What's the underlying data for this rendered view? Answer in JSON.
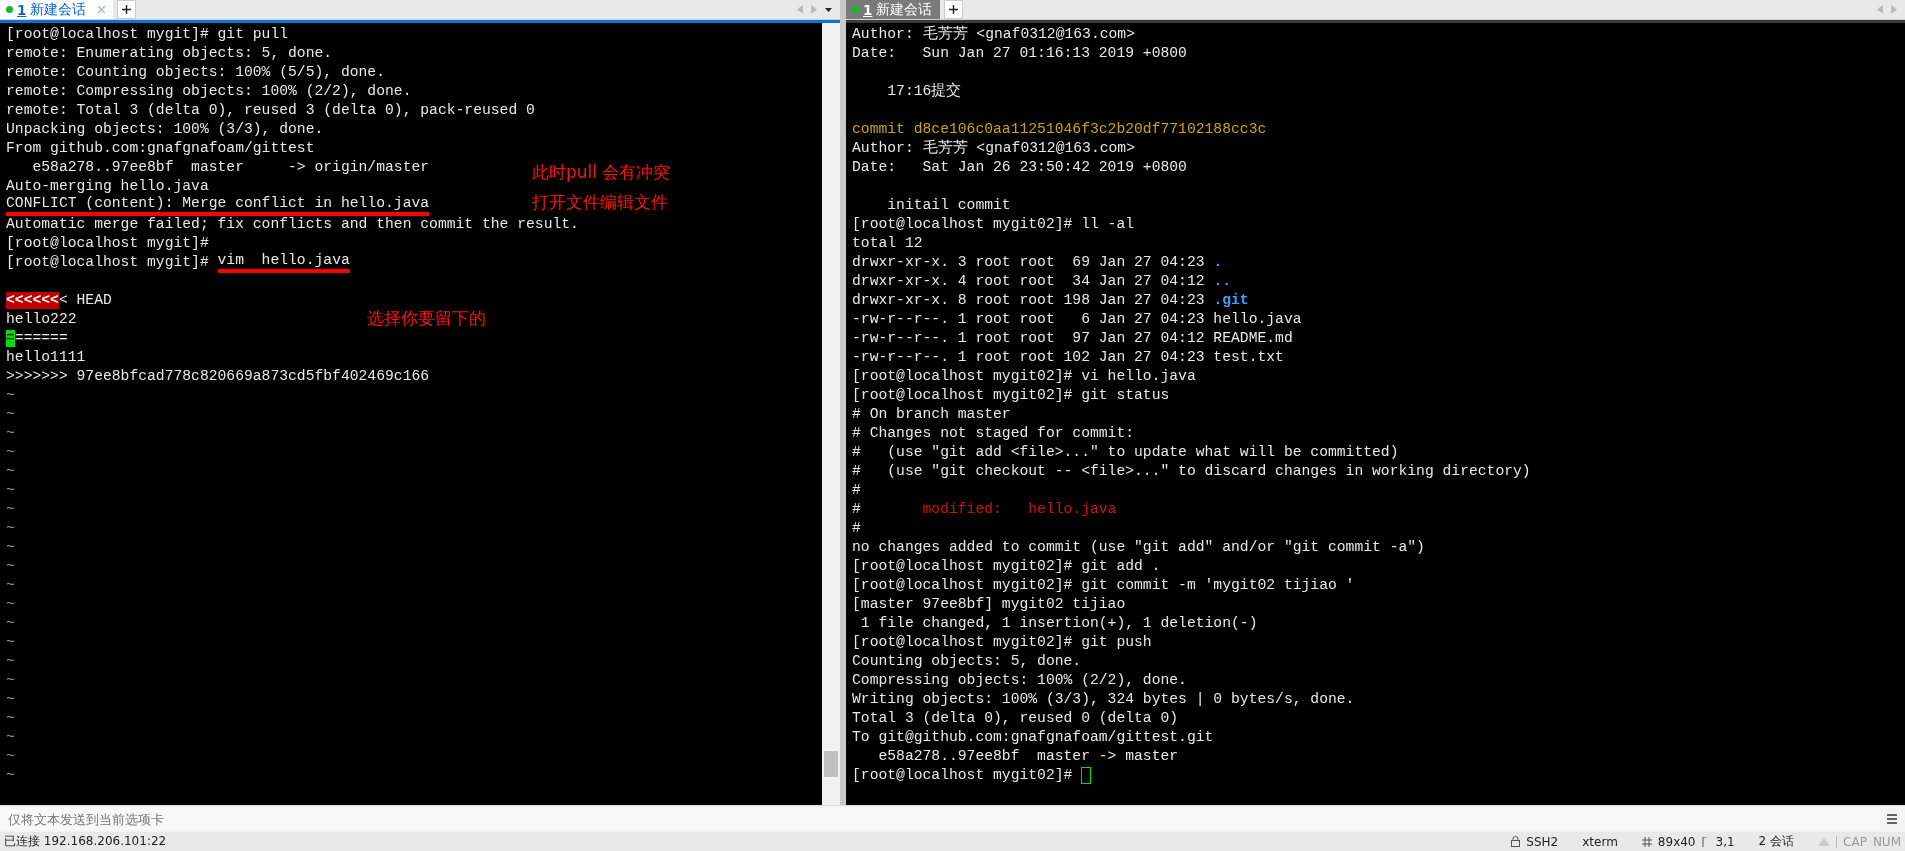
{
  "panes": [
    {
      "tabs": [
        {
          "number": "1",
          "label": "新建会话",
          "selected": true,
          "connected": true
        }
      ],
      "focused": true,
      "lines": [
        {
          "segments": [
            {
              "text": "[root@localhost mygit]# git pull"
            }
          ]
        },
        {
          "segments": [
            {
              "text": "remote: Enumerating objects: 5, done."
            }
          ]
        },
        {
          "segments": [
            {
              "text": "remote: Counting objects: 100% (5/5), done."
            }
          ]
        },
        {
          "segments": [
            {
              "text": "remote: Compressing objects: 100% (2/2), done."
            }
          ]
        },
        {
          "segments": [
            {
              "text": "remote: Total 3 (delta 0), reused 3 (delta 0), pack-reused 0"
            }
          ]
        },
        {
          "segments": [
            {
              "text": "Unpacking objects: 100% (3/3), done."
            }
          ]
        },
        {
          "segments": [
            {
              "text": "From github.com:gnafgnafoam/gittest"
            }
          ]
        },
        {
          "segments": [
            {
              "text": "   e58a278..97ee8bf  master     -> origin/master"
            }
          ]
        },
        {
          "segments": [
            {
              "text": "Auto-merging hello.java"
            }
          ]
        },
        {
          "segments": [
            {
              "text": "CONFLICT (content): Merge conflict in hello.java",
              "underlined": true
            }
          ]
        },
        {
          "segments": [
            {
              "text": "Automatic merge failed; fix conflicts and then commit the result."
            }
          ]
        },
        {
          "segments": [
            {
              "text": "[root@localhost mygit]#"
            }
          ]
        },
        {
          "segments": [
            {
              "text": "[root@localhost mygit]# "
            },
            {
              "text": "vim  hello.java",
              "underlined": true
            }
          ]
        },
        {
          "kind": "blank"
        },
        {
          "segments": [
            {
              "text": "<<<<<<",
              "kind": "highlight"
            },
            {
              "text": "< HEAD"
            }
          ]
        },
        {
          "segments": [
            {
              "text": "hello222"
            }
          ]
        },
        {
          "segments": [
            {
              "text": "=",
              "kind": "cursor"
            },
            {
              "text": "======"
            }
          ]
        },
        {
          "segments": [
            {
              "text": "hello1111"
            }
          ]
        },
        {
          "segments": [
            {
              "text": ">>>>>>> 97ee8bfcad778c820669a873cd5fbf402469c166"
            }
          ]
        },
        {
          "kind": "tilde",
          "segments": [
            {
              "text": "~"
            }
          ]
        },
        {
          "kind": "tilde",
          "segments": [
            {
              "text": "~"
            }
          ]
        },
        {
          "kind": "tilde",
          "segments": [
            {
              "text": "~"
            }
          ]
        },
        {
          "kind": "tilde",
          "segments": [
            {
              "text": "~"
            }
          ]
        },
        {
          "kind": "tilde",
          "segments": [
            {
              "text": "~"
            }
          ]
        },
        {
          "kind": "tilde",
          "segments": [
            {
              "text": "~"
            }
          ]
        },
        {
          "kind": "tilde",
          "segments": [
            {
              "text": "~"
            }
          ]
        },
        {
          "kind": "tilde",
          "segments": [
            {
              "text": "~"
            }
          ]
        },
        {
          "kind": "tilde",
          "segments": [
            {
              "text": "~"
            }
          ]
        },
        {
          "kind": "tilde",
          "segments": [
            {
              "text": "~"
            }
          ]
        },
        {
          "kind": "tilde",
          "segments": [
            {
              "text": "~"
            }
          ]
        },
        {
          "kind": "tilde",
          "segments": [
            {
              "text": "~"
            }
          ]
        },
        {
          "kind": "tilde",
          "segments": [
            {
              "text": "~"
            }
          ]
        },
        {
          "kind": "tilde",
          "segments": [
            {
              "text": "~"
            }
          ]
        },
        {
          "kind": "tilde",
          "segments": [
            {
              "text": "~"
            }
          ]
        },
        {
          "kind": "tilde",
          "segments": [
            {
              "text": "~"
            }
          ]
        },
        {
          "kind": "tilde",
          "segments": [
            {
              "text": "~"
            }
          ]
        },
        {
          "kind": "tilde",
          "segments": [
            {
              "text": "~"
            }
          ]
        },
        {
          "kind": "tilde",
          "segments": [
            {
              "text": "~"
            }
          ]
        },
        {
          "kind": "tilde",
          "segments": [
            {
              "text": "~"
            }
          ]
        },
        {
          "kind": "tilde",
          "segments": [
            {
              "text": "~"
            }
          ]
        }
      ],
      "annotations": [
        {
          "text": "此时pull  会有冲突"
        },
        {
          "text": "打开文件编辑文件"
        },
        {
          "text": "选择你要留下的"
        }
      ]
    },
    {
      "tabs": [
        {
          "number": "1",
          "label": "新建会话",
          "selected": true,
          "connected": true
        }
      ],
      "focused": false,
      "lines": [
        {
          "segments": [
            {
              "text": "Author: 毛芳芳 <gnaf0312@163.com>"
            }
          ]
        },
        {
          "segments": [
            {
              "text": "Date:   Sun Jan 27 01:16:13 2019 +0800"
            }
          ]
        },
        {
          "kind": "blank"
        },
        {
          "segments": [
            {
              "text": "    17:16提交"
            }
          ]
        },
        {
          "kind": "blank"
        },
        {
          "segments": [
            {
              "text": "commit d8ce106c0aa11251046f3c2b20df77102188cc3c",
              "kind": "commit-hash"
            }
          ]
        },
        {
          "segments": [
            {
              "text": "Author: 毛芳芳 <gnaf0312@163.com>"
            }
          ]
        },
        {
          "segments": [
            {
              "text": "Date:   Sat Jan 26 23:50:42 2019 +0800"
            }
          ]
        },
        {
          "kind": "blank"
        },
        {
          "segments": [
            {
              "text": "    initail commit"
            }
          ]
        },
        {
          "segments": [
            {
              "text": "[root@localhost mygit02]# ll -al"
            }
          ]
        },
        {
          "segments": [
            {
              "text": "total 12"
            }
          ]
        },
        {
          "segments": [
            {
              "text": "drwxr-xr-x. 3 root root  69 Jan 27 04:23 "
            },
            {
              "text": ".",
              "kind": "directory"
            }
          ]
        },
        {
          "segments": [
            {
              "text": "drwxr-xr-x. 4 root root  34 Jan 27 04:12 "
            },
            {
              "text": "..",
              "kind": "directory"
            }
          ]
        },
        {
          "segments": [
            {
              "text": "drwxr-xr-x. 8 root root 198 Jan 27 04:23 "
            },
            {
              "text": ".git",
              "kind": "directory"
            }
          ]
        },
        {
          "segments": [
            {
              "text": "-rw-r--r--. 1 root root   6 Jan 27 04:23 hello.java"
            }
          ]
        },
        {
          "segments": [
            {
              "text": "-rw-r--r--. 1 root root  97 Jan 27 04:12 README.md"
            }
          ]
        },
        {
          "segments": [
            {
              "text": "-rw-r--r--. 1 root root 102 Jan 27 04:23 test.txt"
            }
          ]
        },
        {
          "segments": [
            {
              "text": "[root@localhost mygit02]# vi hello.java"
            }
          ]
        },
        {
          "segments": [
            {
              "text": "[root@localhost mygit02]# git status"
            }
          ]
        },
        {
          "segments": [
            {
              "text": "# On branch master"
            }
          ]
        },
        {
          "segments": [
            {
              "text": "# Changes not staged for commit:"
            }
          ]
        },
        {
          "segments": [
            {
              "text": "#   (use \"git add <file>...\" to update what will be committed)"
            }
          ]
        },
        {
          "segments": [
            {
              "text": "#   (use \"git checkout -- <file>...\" to discard changes in working directory)"
            }
          ]
        },
        {
          "segments": [
            {
              "text": "#"
            }
          ]
        },
        {
          "segments": [
            {
              "text": "#       "
            },
            {
              "text": "modified:   hello.java",
              "kind": "modified"
            }
          ]
        },
        {
          "segments": [
            {
              "text": "#"
            }
          ]
        },
        {
          "segments": [
            {
              "text": "no changes added to commit (use \"git add\" and/or \"git commit -a\")"
            }
          ]
        },
        {
          "segments": [
            {
              "text": "[root@localhost mygit02]# git add ."
            }
          ]
        },
        {
          "segments": [
            {
              "text": "[root@localhost mygit02]# git commit -m 'mygit02 tijiao '"
            }
          ]
        },
        {
          "segments": [
            {
              "text": "[master 97ee8bf] mygit02 tijiao"
            }
          ]
        },
        {
          "segments": [
            {
              "text": " 1 file changed, 1 insertion(+), 1 deletion(-)"
            }
          ]
        },
        {
          "segments": [
            {
              "text": "[root@localhost mygit02]# git push"
            }
          ]
        },
        {
          "segments": [
            {
              "text": "Counting objects: 5, done."
            }
          ]
        },
        {
          "segments": [
            {
              "text": "Compressing objects: 100% (2/2), done."
            }
          ]
        },
        {
          "segments": [
            {
              "text": "Writing objects: 100% (3/3), 324 bytes | 0 bytes/s, done."
            }
          ]
        },
        {
          "segments": [
            {
              "text": "Total 3 (delta 0), reused 0 (delta 0)"
            }
          ]
        },
        {
          "segments": [
            {
              "text": "To git@github.com:gnafgnafoam/gittest.git"
            }
          ]
        },
        {
          "segments": [
            {
              "text": "   e58a278..97ee8bf  master -> master"
            }
          ]
        },
        {
          "kind": "prompt-with-cursor",
          "segments": [
            {
              "text": "[root@localhost mygit02]# "
            }
          ]
        }
      ]
    }
  ],
  "send_bar": {
    "placeholder": "仅将文本发送到当前选项卡"
  },
  "status_bar": {
    "connection": "已连接 192.168.206.101:22",
    "protocol": "SSH2",
    "terminal": "xterm",
    "size": "89x40",
    "cursor": "3,1",
    "sessions": "2 会话",
    "caps": "CAP",
    "num": "NUM"
  }
}
